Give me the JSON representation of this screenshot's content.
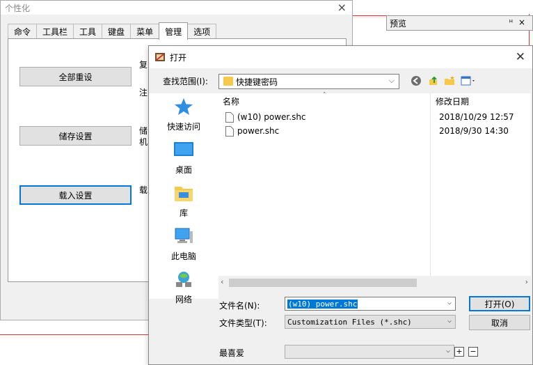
{
  "personalize_window": {
    "title": "个性化",
    "tabs": [
      "命令",
      "工具栏",
      "工具",
      "键盘",
      "菜单",
      "管理",
      "选项"
    ],
    "active_tab_index": 5,
    "buttons": {
      "reset_all": "全部重设",
      "save_settings": "储存设置",
      "load_settings": "载入设置"
    },
    "side_texts": {
      "t1": "复",
      "t2": "注",
      "t3": "储",
      "t4": "机",
      "t5": "载"
    }
  },
  "preview_pane": {
    "title": "预览",
    "pin_glyph": "ᵸ",
    "close_glyph": "×"
  },
  "open_dialog": {
    "title": "打开",
    "look_in_label": "查找范围(I):",
    "look_in_value": "快捷键密码",
    "places": [
      "快速访问",
      "桌面",
      "库",
      "此电脑",
      "网络"
    ],
    "columns": {
      "name": "名称",
      "modified": "修改日期"
    },
    "files": [
      {
        "name": "(w10) power.shc",
        "modified": "2018/10/29 12:57"
      },
      {
        "name": "power.shc",
        "modified": "2018/9/30 14:30"
      }
    ],
    "filename_label": "文件名(N):",
    "filename_value": "(w10) power.shc",
    "filetype_label": "文件类型(T):",
    "filetype_value": "Customization Files (*.shc)",
    "favorites_label": "最喜爱",
    "favorites_value": "",
    "open_button": "打开(O)",
    "cancel_button": "取消",
    "plus_glyph": "+",
    "minus_glyph": "−"
  },
  "colors": {
    "accent": "#0078d7",
    "folder": "#f6c94a",
    "dialog_bg": "#f0f0f0"
  }
}
